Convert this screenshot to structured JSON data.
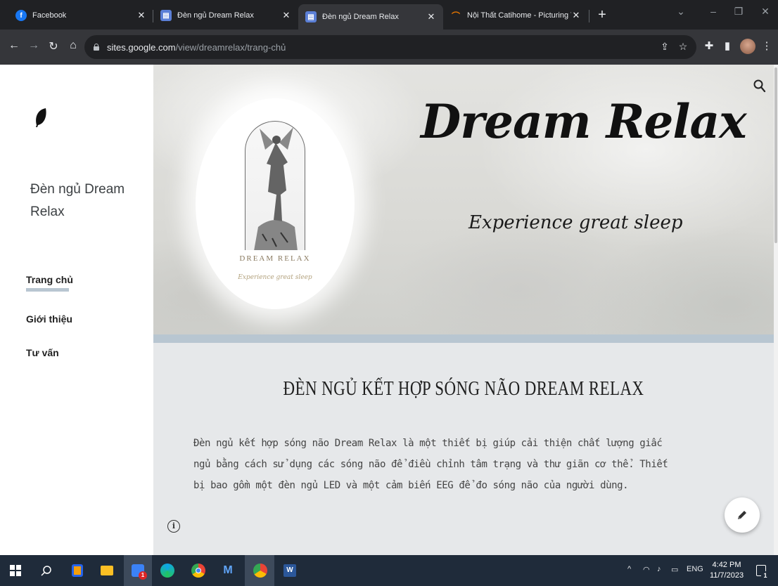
{
  "browser": {
    "tabs": [
      {
        "title": "Facebook",
        "favicon": "facebook-icon",
        "active": false
      },
      {
        "title": "Đèn ngủ Dream Relax",
        "favicon": "google-sites-icon",
        "active": false
      },
      {
        "title": "Đèn ngủ Dream Relax",
        "favicon": "google-sites-icon",
        "active": true
      },
      {
        "title": "Nội Thất Catihome - Picturing Yo",
        "favicon": "catihome-icon",
        "active": false
      }
    ],
    "url_host": "sites.google.com",
    "url_path": "/view/dreamrelax/trang-chủ"
  },
  "sidebar": {
    "site_name": "Đèn ngủ Dream Relax",
    "nav": [
      {
        "label": "Trang chủ",
        "active": true
      },
      {
        "label": "Giới thiệu",
        "active": false
      },
      {
        "label": "Tư vấn",
        "active": false
      }
    ]
  },
  "hero": {
    "title": "Dream Relax",
    "subtitle": "Experience great sleep",
    "logo_brand": "DREAM RELAX",
    "logo_tagline": "Experience great sleep"
  },
  "content": {
    "heading": "ĐÈN NGỦ KẾT HỢP SÓNG NÃO DREAM RELAX",
    "paragraph_lines": [
      "Đèn ngủ kết hợp sóng não Dream Relax là một thiết bị giúp cải thiện chất lượng giấc",
      "ngủ bằng cách sử dụng các sóng não để điều chỉnh tâm trạng và thư giãn cơ thể. Thiết",
      "bị bao gồm một đèn ngủ LED và một cảm biến EEG để đo sóng não của người dùng."
    ]
  },
  "taskbar": {
    "language": "ENG",
    "time": "4:42 PM",
    "date": "11/7/2023",
    "notification_count": "1",
    "mail_badge": "1"
  },
  "colors": {
    "accent_underline": "#b8c6d1",
    "content_bg": "#e6e8ea",
    "taskbar_bg": "#1f2b3a"
  }
}
